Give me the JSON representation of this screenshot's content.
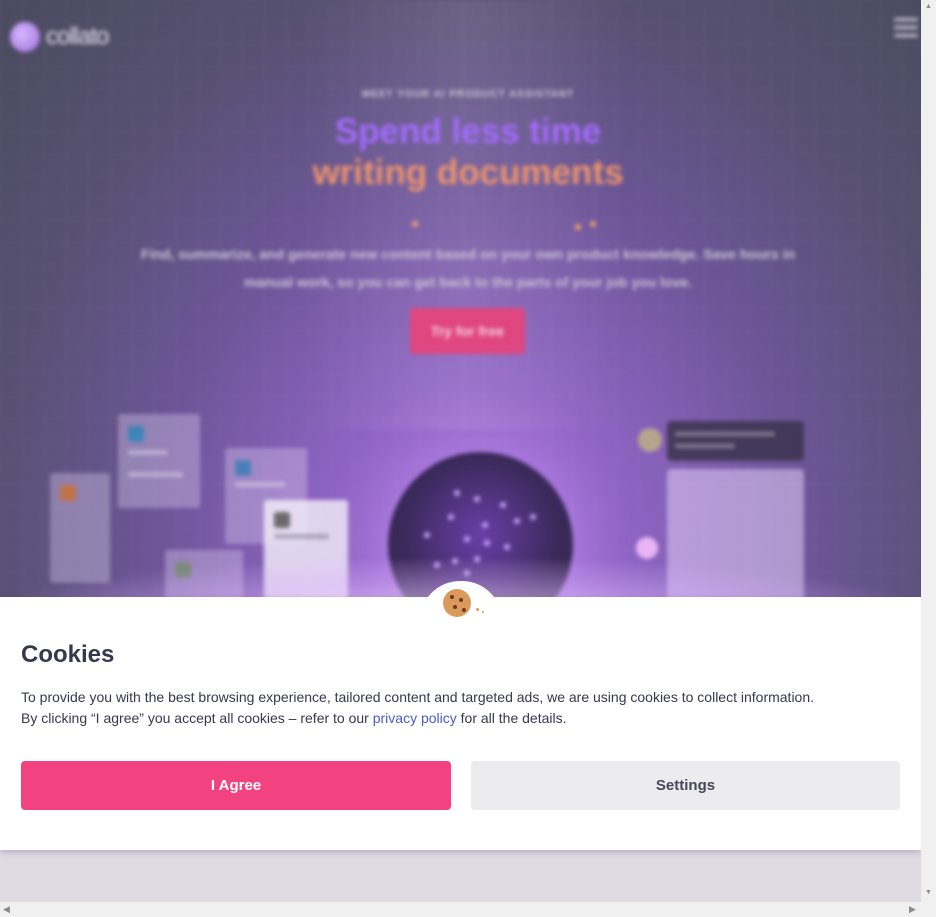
{
  "site": {
    "logo_text": "collato",
    "eyebrow": "MEET YOUR AI PRODUCT ASSISTANT",
    "headline_line1": "Spend less time",
    "headline_line2": "writing documents",
    "subtitle_line1": "Find, summarize, and generate new content based on your own product knowledge. Save hours in",
    "subtitle_line2": "manual work, so you can get back to the parts of your job you love.",
    "cta_label": "Try for free",
    "brand_purple": "#a46cff",
    "brand_orange": "#ee946c"
  },
  "cookie_banner": {
    "title": "Cookies",
    "text_line1": "To provide you with the best browsing experience, tailored content and targeted ads, we are using cookies to collect information.",
    "text_line2_before": "By clicking “I agree” you accept all cookies – refer to our ",
    "privacy_link": "privacy policy",
    "text_line2_after": " for all the details.",
    "agree_label": "I Agree",
    "settings_label": "Settings",
    "agree_color": "#f2427f",
    "link_color": "#4b5ac8"
  },
  "scrollbars": {
    "up_arrow": "▲",
    "down_arrow": "▼",
    "left_arrow": "◀",
    "right_arrow": "▶"
  }
}
